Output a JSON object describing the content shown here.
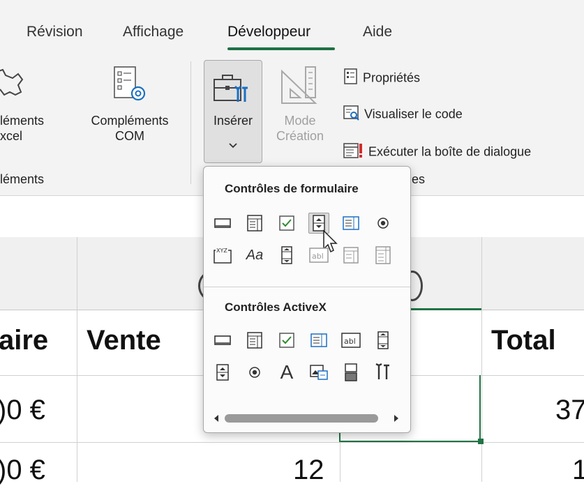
{
  "tabs": [
    "Révision",
    "Affichage",
    "Développeur",
    "Aide"
  ],
  "active_tab": "Développeur",
  "ribbon": {
    "complements_excel": [
      "léments",
      "xcel"
    ],
    "complements_com": [
      "Compléments",
      "COM"
    ],
    "group_addins_label": "léments",
    "inserer": "Insérer",
    "mode_creation": [
      "Mode",
      "Création"
    ],
    "proprietes": "Propriétés",
    "visualiser_code": "Visualiser le code",
    "executer_boite": "Exécuter la boîte de dialogue",
    "group_controls_label_partial": "les"
  },
  "grid": {
    "header_left": "aire",
    "header_vente": "Vente",
    "header_total": "Total",
    "row1_a": ")0 €",
    "row1_total": "37",
    "row2_a": ")0 €",
    "row2_b": "12",
    "row2_total": "1"
  },
  "dropdown": {
    "form_controls_title": "Contrôles de formulaire",
    "activex_title": "Contrôles ActiveX",
    "form_controls_row1": [
      "button-icon",
      "combo-box-icon",
      "check-box-icon",
      "spin-button-icon",
      "list-box-icon",
      "option-button-icon"
    ],
    "form_controls_row2": [
      "group-box-icon",
      "label-icon",
      "scroll-bar-icon",
      "text-field-icon",
      "combo-list-edit-icon",
      "combo-dropdown-edit-icon"
    ],
    "activex_row1": [
      "button-icon",
      "combo-box-icon",
      "check-box-icon",
      "list-box-icon",
      "text-box-icon",
      "scroll-bar-icon"
    ],
    "activex_row2": [
      "spin-button-icon",
      "option-button-icon",
      "label-icon",
      "image-icon",
      "toggle-button-icon",
      "more-controls-icon"
    ],
    "form_label_glyph": "Aa",
    "activex_label_glyph": "A",
    "group_box_glyph": "XYZ",
    "text_field_glyph": "abl"
  },
  "colors": {
    "accent_green": "#1e7145",
    "selection_green": "#217346"
  }
}
